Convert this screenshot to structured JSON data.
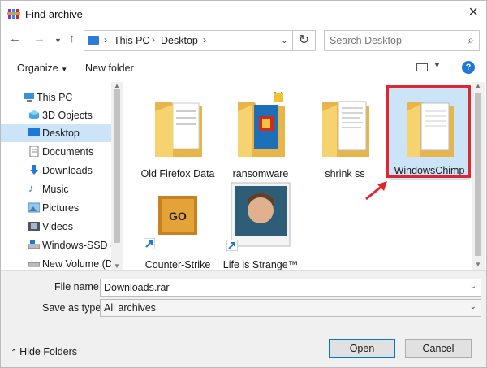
{
  "window": {
    "title": "Find archive"
  },
  "nav": {
    "breadcrumb": [
      "This PC",
      "Desktop"
    ],
    "search_placeholder": "Search Desktop"
  },
  "toolbar": {
    "organize": "Organize",
    "new_folder": "New folder",
    "help": "?"
  },
  "sidebar": {
    "items": [
      {
        "label": "This PC",
        "icon": "pc-icon"
      },
      {
        "label": "3D Objects",
        "icon": "cube-icon"
      },
      {
        "label": "Desktop",
        "icon": "desktop-icon",
        "selected": true
      },
      {
        "label": "Documents",
        "icon": "documents-icon"
      },
      {
        "label": "Downloads",
        "icon": "download-icon"
      },
      {
        "label": "Music",
        "icon": "music-icon"
      },
      {
        "label": "Pictures",
        "icon": "pictures-icon"
      },
      {
        "label": "Videos",
        "icon": "videos-icon"
      },
      {
        "label": "Windows-SSD (C",
        "icon": "drive-icon"
      },
      {
        "label": "New Volume (D:)",
        "icon": "drive-icon"
      }
    ]
  },
  "files": [
    {
      "name": "Old Firefox Data",
      "type": "folder"
    },
    {
      "name": "ransomware",
      "type": "folder-locked"
    },
    {
      "name": "shrink ss",
      "type": "folder"
    },
    {
      "name": "WindowsChimp",
      "type": "folder",
      "selected": true
    },
    {
      "name": "Counter-Strike",
      "type": "shortcut"
    },
    {
      "name": "Life is Strange™",
      "type": "shortcut"
    }
  ],
  "form": {
    "file_name_label": "File name:",
    "file_name_value": "Downloads.rar",
    "save_type_label": "Save as type:",
    "save_type_value": "All archives",
    "hide_folders": "Hide Folders",
    "open": "Open",
    "cancel": "Cancel"
  },
  "colors": {
    "accent": "#0078d7",
    "selection": "#cce4f7",
    "highlight": "#e0262e"
  }
}
